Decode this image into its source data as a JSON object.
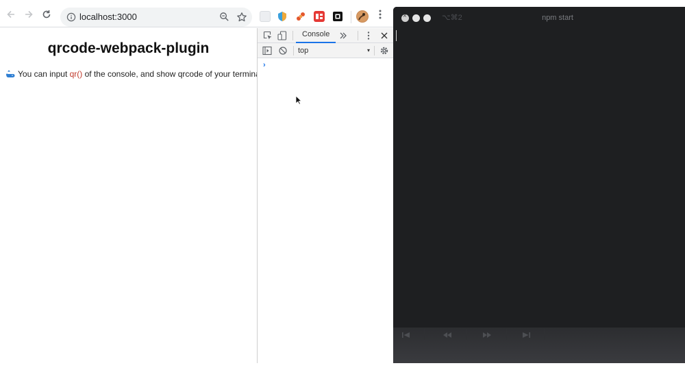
{
  "browser": {
    "url": "localhost:3000",
    "page_title": "qrcode-webpack-plugin",
    "message": {
      "before": "You can input ",
      "code": "qr()",
      "after": " of the console, and show qrcode of your terminal."
    }
  },
  "devtools": {
    "active_tab": "Console",
    "context": "top",
    "prompt": "›"
  },
  "terminal": {
    "shortcut": "⌥⌘2",
    "title": "npm start"
  },
  "colors": {
    "terminal_bg": "#1e1f21",
    "code_text": "#c0392b",
    "devtools_accent": "#1a73e8"
  }
}
